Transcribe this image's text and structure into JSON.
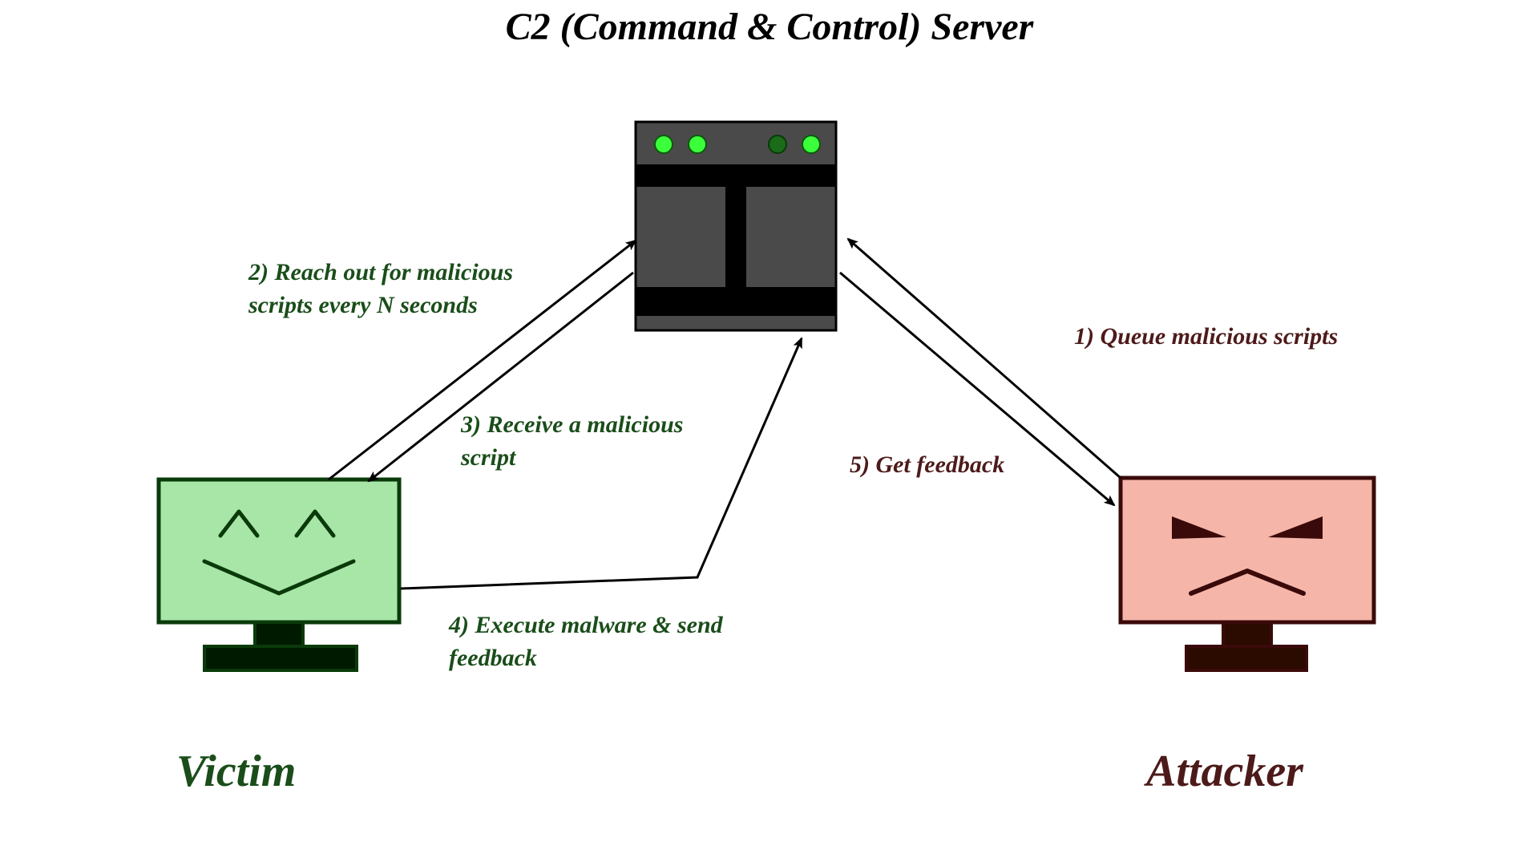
{
  "server": {
    "title": "C2 (Command & Control) Server"
  },
  "victim": {
    "label": "Victim"
  },
  "attacker": {
    "label": "Attacker"
  },
  "steps": {
    "s1": "1) Queue malicious scripts",
    "s2": "2) Reach out for malicious scripts every N seconds",
    "s3": "3) Receive a malicious script",
    "s4": "4) Execute malware & send feedback",
    "s5": "5) Get feedback"
  }
}
